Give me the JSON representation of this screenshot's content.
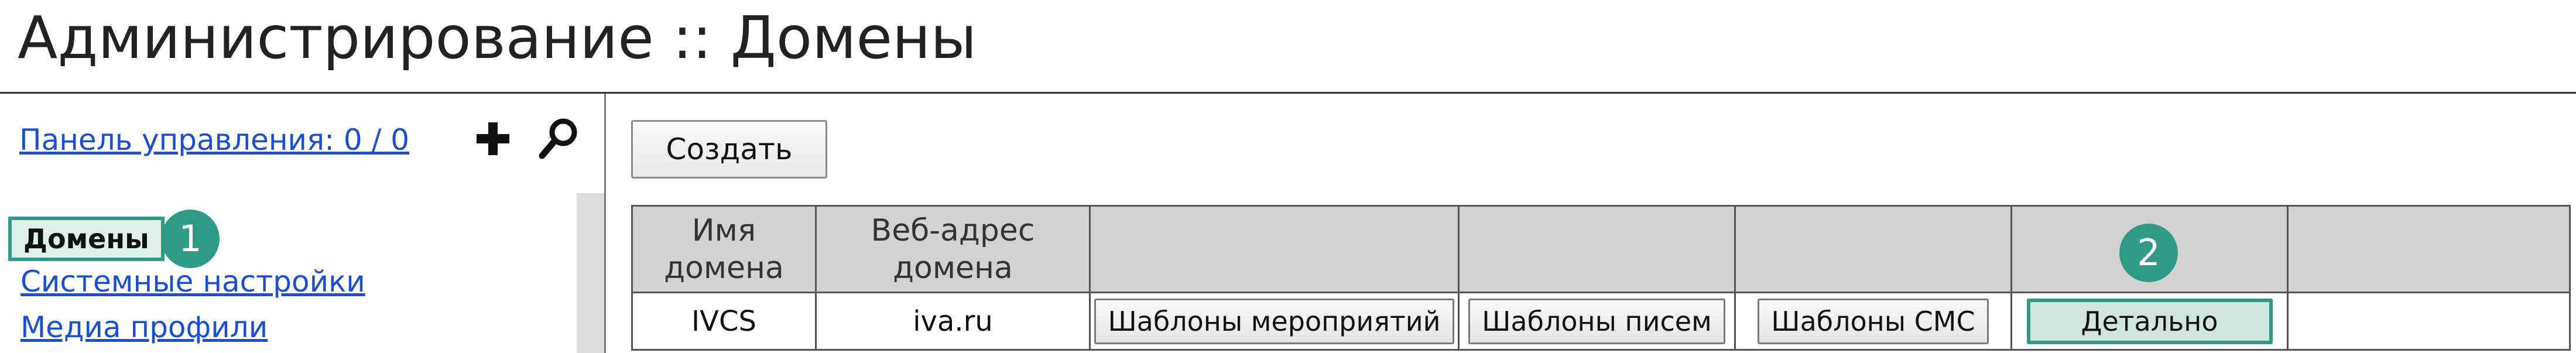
{
  "page": {
    "title": "Администрирование :: Домены"
  },
  "sidebar": {
    "dashboard_link": "Панель управления: 0 / 0",
    "add_icon": "plus-icon",
    "search_icon": "search-icon",
    "items": [
      {
        "label": "Домены",
        "active": true
      },
      {
        "label": "Системные настройки",
        "active": false
      },
      {
        "label": "Медиа профили",
        "active": false
      }
    ]
  },
  "badges": {
    "first": "1",
    "second": "2"
  },
  "toolbar": {
    "create_label": "Создать"
  },
  "table": {
    "columns": [
      "Имя домена",
      "Веб-адрес домена",
      "",
      "",
      "",
      "",
      ""
    ],
    "rows": [
      {
        "name": "IVCS",
        "web_address": "iva.ru",
        "events_templates": "Шаблоны мероприятий",
        "letter_templates": "Шаблоны писем",
        "sms_templates": "Шаблоны СМС",
        "details": "Детально"
      }
    ]
  },
  "colors": {
    "accent": "#2f9b86",
    "link": "#1a4fd1",
    "header_bg": "#d2d2d2"
  }
}
